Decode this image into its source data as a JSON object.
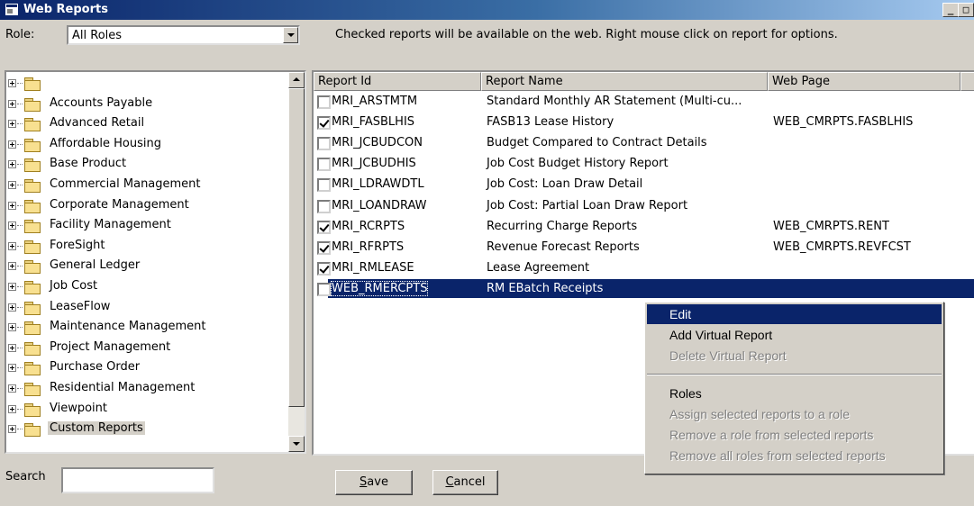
{
  "window": {
    "title": "Web Reports"
  },
  "role": {
    "label": "Role:",
    "selected": "All Roles"
  },
  "instructions": "Checked reports will be available on the web.  Right mouse click on report for options.",
  "tree": {
    "items": [
      {
        "label": ""
      },
      {
        "label": "Accounts Payable"
      },
      {
        "label": "Advanced Retail"
      },
      {
        "label": "Affordable Housing"
      },
      {
        "label": "Base Product"
      },
      {
        "label": "Commercial Management"
      },
      {
        "label": "Corporate Management"
      },
      {
        "label": "Facility Management"
      },
      {
        "label": "ForeSight"
      },
      {
        "label": "General Ledger"
      },
      {
        "label": "Job Cost"
      },
      {
        "label": "LeaseFlow"
      },
      {
        "label": "Maintenance Management"
      },
      {
        "label": "Project Management"
      },
      {
        "label": "Purchase Order"
      },
      {
        "label": "Residential Management"
      },
      {
        "label": "Viewpoint"
      },
      {
        "label": "Custom Reports"
      }
    ]
  },
  "grid": {
    "columns": [
      "Report Id",
      "Report Name",
      "Web Page"
    ],
    "rows": [
      {
        "checked": false,
        "id": "MRI_ARSTMTM",
        "name": "Standard Monthly AR Statement (Multi-cu...",
        "page": ""
      },
      {
        "checked": true,
        "id": "MRI_FASBLHIS",
        "name": "FASB13 Lease History",
        "page": "WEB_CMRPTS.FASBLHIS"
      },
      {
        "checked": false,
        "id": "MRI_JCBUDCON",
        "name": "Budget Compared to Contract Details",
        "page": ""
      },
      {
        "checked": false,
        "id": "MRI_JCBUDHIS",
        "name": "Job Cost Budget History Report",
        "page": ""
      },
      {
        "checked": false,
        "id": "MRI_LDRAWDTL",
        "name": "Job Cost:  Loan Draw Detail",
        "page": ""
      },
      {
        "checked": false,
        "id": "MRI_LOANDRAW",
        "name": "Job Cost: Partial Loan Draw Report",
        "page": ""
      },
      {
        "checked": true,
        "id": "MRI_RCRPTS",
        "name": "Recurring Charge Reports",
        "page": "WEB_CMRPTS.RENT"
      },
      {
        "checked": true,
        "id": "MRI_RFRPTS",
        "name": "Revenue Forecast Reports",
        "page": "WEB_CMRPTS.REVFCST"
      },
      {
        "checked": true,
        "id": "MRI_RMLEASE",
        "name": "Lease Agreement",
        "page": ""
      },
      {
        "checked": false,
        "id": "WEB_RMERCPTS",
        "name": "RM EBatch Receipts",
        "page": "",
        "selected": true
      }
    ]
  },
  "search": {
    "label": "Search",
    "value": ""
  },
  "buttons": {
    "save": "Save",
    "cancel": "Cancel"
  },
  "context_menu": {
    "items": [
      {
        "label": "Edit",
        "enabled": true,
        "highlighted": true
      },
      {
        "label": "Add Virtual Report",
        "enabled": true
      },
      {
        "label": "Delete Virtual Report",
        "enabled": false
      },
      {
        "label": "Roles",
        "enabled": true
      },
      {
        "label": "Assign selected reports to a role",
        "enabled": false
      },
      {
        "label": "Remove a role from selected reports",
        "enabled": false
      },
      {
        "label": "Remove all roles from selected reports",
        "enabled": false
      }
    ]
  }
}
